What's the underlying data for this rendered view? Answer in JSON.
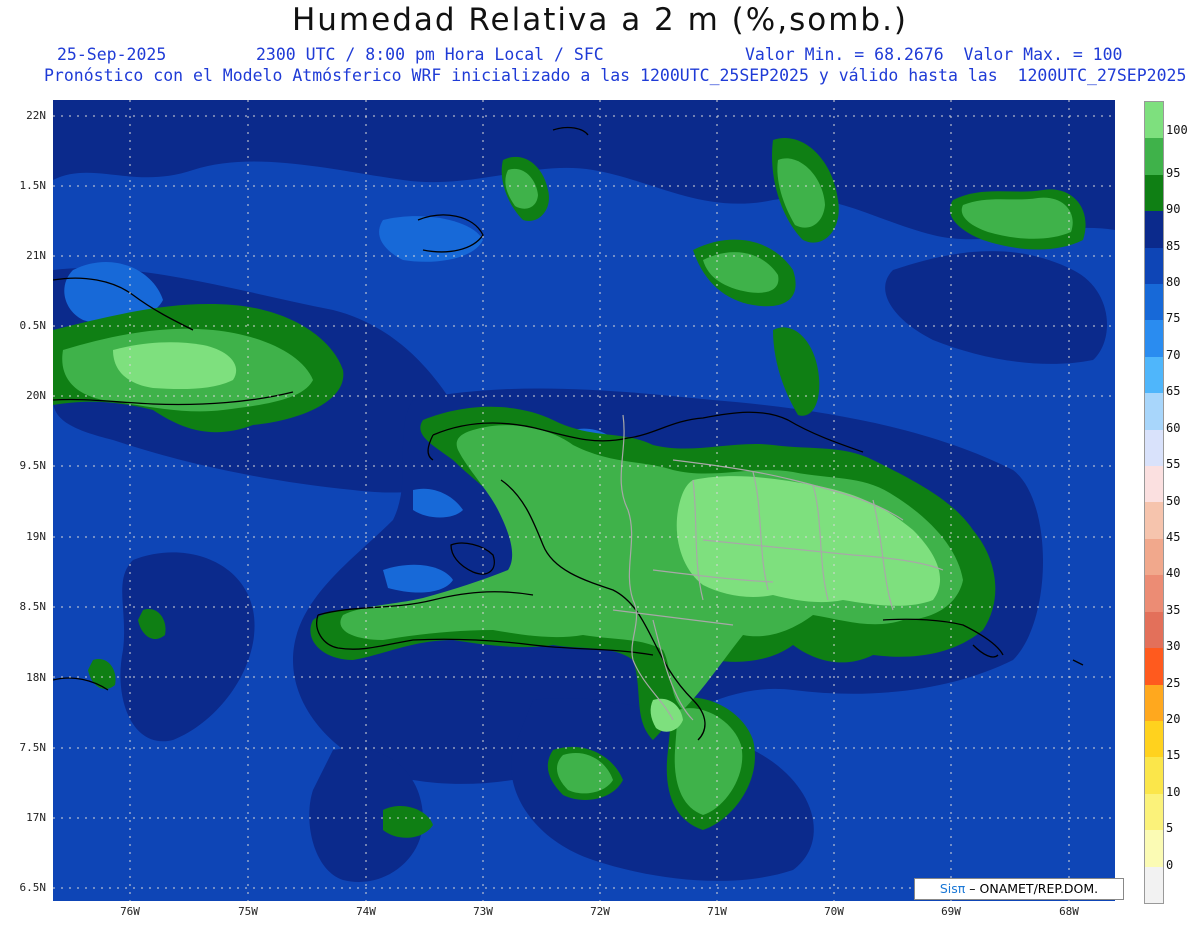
{
  "header": {
    "title": "Humedad Relativa a 2 m (%,somb.)",
    "date": "25-Sep-2025",
    "valid_time": "2300 UTC / 8:00 pm Hora Local / SFC",
    "minmax": "Valor Min. = 68.2676  Valor Max. = 100",
    "forecast_info": "Pronóstico con el Modelo Atmósferico WRF inicializado a las 1200UTC_25SEP2025 y válido hasta las  1200UTC_27SEP2025"
  },
  "axes": {
    "lat_labels": [
      "22N",
      "1.5N",
      "21N",
      "0.5N",
      "20N",
      "9.5N",
      "19N",
      "8.5N",
      "18N",
      "7.5N",
      "17N",
      "6.5N"
    ],
    "lon_labels": [
      "76W",
      "75W",
      "74W",
      "73W",
      "72W",
      "71W",
      "70W",
      "69W",
      "68W"
    ]
  },
  "colorbar": {
    "labels": [
      "100",
      "95",
      "90",
      "85",
      "80",
      "75",
      "70",
      "65",
      "60",
      "55",
      "50",
      "45",
      "40",
      "35",
      "30",
      "25",
      "20",
      "15",
      "10",
      "5",
      "0"
    ],
    "colors": [
      "#7ee07e",
      "#3fb24a",
      "#0f7f14",
      "#0b2a8c",
      "#0e45b6",
      "#1769d8",
      "#2a8cf0",
      "#4fb6fb",
      "#a8d6fb",
      "#d9e2fb",
      "#fbe0e0",
      "#f6c4ad",
      "#f1a88c",
      "#ec8c74",
      "#e3705a",
      "#ff5a1e",
      "#ffa81e",
      "#ffd21e",
      "#fbe64a",
      "#fbf27a",
      "#fbfbb4",
      "#f2f2f2"
    ]
  },
  "credit": {
    "sis": "Sisπ",
    "org": "– ONAMET/REP.DOM."
  },
  "colors": {
    "background_ocean": "#0e45b6",
    "deep_blue": "#0b2a8c",
    "mid_blue": "#1769d8",
    "light_blue": "#2a8cf0",
    "green_95": "#3fb24a",
    "green_90": "#0f7f14",
    "green_100": "#7ee07e",
    "title_text": "#1f3bd6"
  }
}
